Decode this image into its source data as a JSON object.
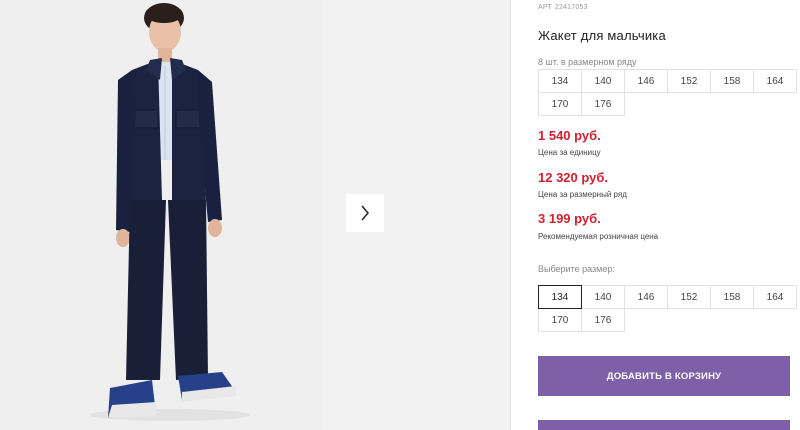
{
  "gallery": {
    "main_image_alt": "",
    "next_icon": "chevron-right-icon"
  },
  "product": {
    "article_label": "АРТ",
    "article_number": "22417053",
    "title": "Жакет для мальчика"
  },
  "size_range": {
    "caption": "8 шт. в размерном ряду",
    "sizes": [
      "134",
      "140",
      "146",
      "152",
      "158",
      "164",
      "170",
      "176"
    ]
  },
  "prices": [
    {
      "value": "1 540 руб.",
      "label": "Цена за единицу"
    },
    {
      "value": "12 320 руб.",
      "label": "Цена за размерный ряд"
    },
    {
      "value": "3 199 руб.",
      "label": "Рекомендуемая розничная цена"
    }
  ],
  "size_select": {
    "caption": "Выберите размер:",
    "sizes": [
      "134",
      "140",
      "146",
      "152",
      "158",
      "164",
      "170",
      "176"
    ],
    "selected": "134"
  },
  "cart": {
    "add_label": "ДОБАВИТЬ В КОРЗИНУ"
  },
  "colors": {
    "accent": "#7d60a8",
    "price": "#d0212e",
    "jacket": "#1b2340"
  }
}
